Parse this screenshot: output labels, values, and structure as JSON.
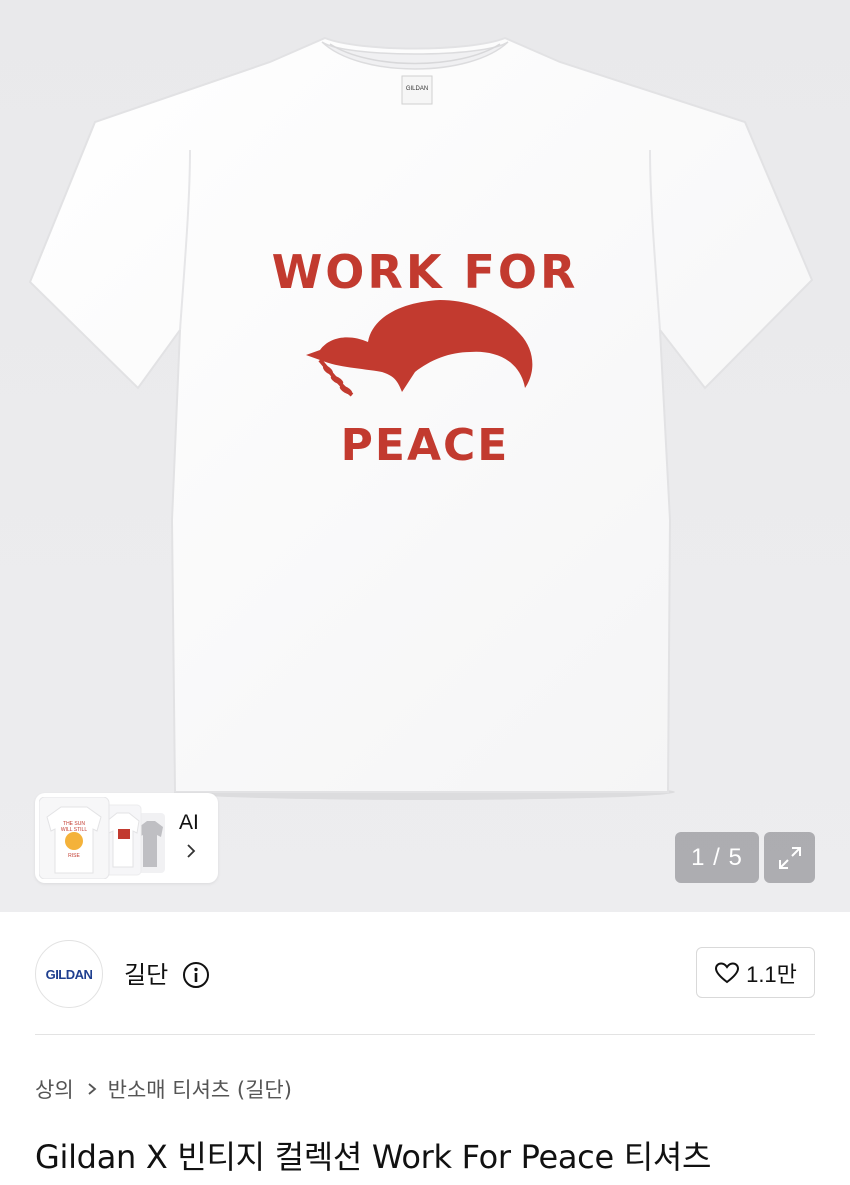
{
  "hero": {
    "shirt_print": {
      "line1": "WORK FOR",
      "line2": "PEACE",
      "print_color": "#c23a2f"
    },
    "tag_text": "GILDAN",
    "counter": "1 / 5",
    "expand_icon": "expand-icon"
  },
  "ai_card": {
    "label": "AI",
    "thumb1_text": "THE SUN WILL STILL RISE",
    "icon": "chevron-right-icon"
  },
  "brand": {
    "logo_text": "GILDAN",
    "name": "길단",
    "info_icon": "info-icon",
    "likes": "1.1만",
    "logo_color": "#1f3f8f"
  },
  "breadcrumb": {
    "items": [
      "상의",
      "반소매 티셔츠 (길단)"
    ]
  },
  "product": {
    "title": "Gildan X 빈티지 컬렉션 Work For Peace 티셔츠"
  }
}
